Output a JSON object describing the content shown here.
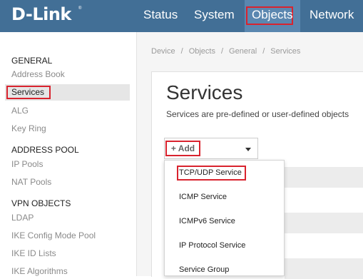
{
  "header": {
    "logo": "D-Link",
    "registered_mark": "®",
    "nav": [
      "Status",
      "System",
      "Objects",
      "Network"
    ],
    "active_nav": "Objects"
  },
  "sidebar": {
    "sections": [
      {
        "heading": "GENERAL",
        "items": [
          "Address Book",
          "Services",
          "ALG",
          "Key Ring"
        ]
      },
      {
        "heading": "ADDRESS POOL",
        "items": [
          "IP Pools",
          "NAT Pools"
        ]
      },
      {
        "heading": "VPN OBJECTS",
        "items": [
          "LDAP",
          "IKE Config Mode Pool",
          "IKE ID Lists",
          "IKE Algorithms"
        ]
      }
    ],
    "selected": "Services"
  },
  "breadcrumb": [
    "Device",
    "Objects",
    "General",
    "Services"
  ],
  "page": {
    "title": "Services",
    "description": "Services are pre-defined or user-defined objects"
  },
  "toolbar": {
    "add_label": "+ Add"
  },
  "add_menu": {
    "items": [
      "TCP/UDP Service",
      "ICMP Service",
      "ICMPv6 Service",
      "IP Protocol Service",
      "Service Group"
    ]
  },
  "colors": {
    "header_bg": "#426f96",
    "active_nav_bg": "#5a87b0",
    "highlight_outline": "#d9232e",
    "content_bg": "#f5f5f5"
  }
}
